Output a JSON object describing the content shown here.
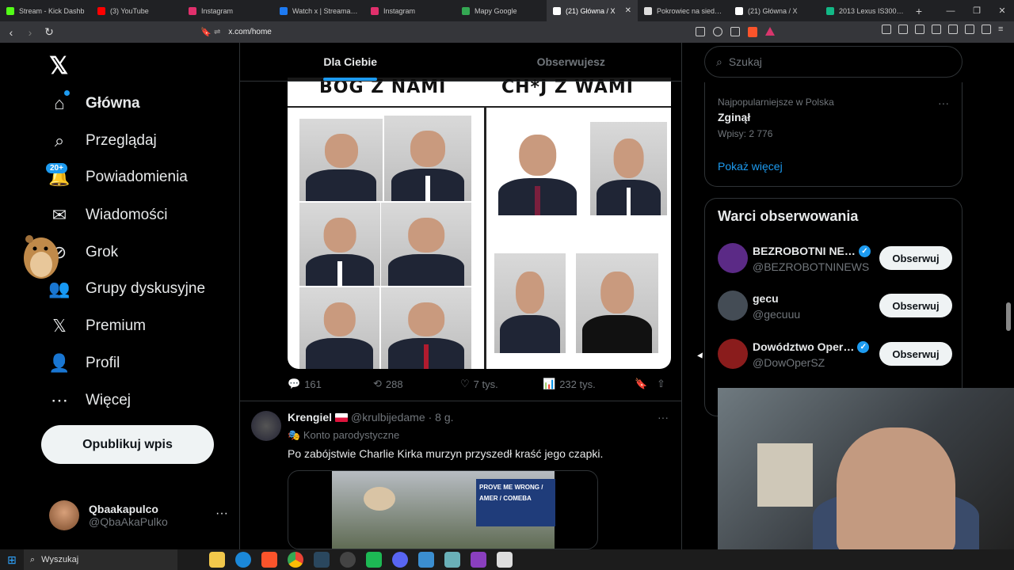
{
  "browser": {
    "tabs": [
      {
        "title": "Stream - Kick Dashb",
        "color": "#53fc18"
      },
      {
        "title": "(3) YouTube",
        "color": "#ff0000"
      },
      {
        "title": "Instagram",
        "color": "#e1306c"
      },
      {
        "title": "Watch x | Streamable",
        "color": "#1d7af2"
      },
      {
        "title": "Instagram",
        "color": "#e1306c"
      },
      {
        "title": "Mapy Google",
        "color": "#34a853"
      },
      {
        "title": "(21) Główna / X",
        "color": "#ffffff",
        "active": true
      },
      {
        "title": "Pokrowiec na siedzeni",
        "color": "#dddddd"
      },
      {
        "title": "(21) Główna / X",
        "color": "#ffffff"
      },
      {
        "title": "2013 Lexus IS300h Elit",
        "color": "#12b886"
      }
    ],
    "url": "x.com/home"
  },
  "sidebar": {
    "nav": [
      {
        "label": "Główna",
        "icon": "home-icon",
        "glyph": "⌂"
      },
      {
        "label": "Przeglądaj",
        "icon": "search-icon",
        "glyph": "⌕"
      },
      {
        "label": "Powiadomienia",
        "icon": "bell-icon",
        "glyph": "🔔"
      },
      {
        "label": "Wiadomości",
        "icon": "envelope-icon",
        "glyph": "✉"
      },
      {
        "label": "Grok",
        "icon": "grok-icon",
        "glyph": "⊘"
      },
      {
        "label": "Grupy dyskusyjne",
        "icon": "communities-icon",
        "glyph": "👥"
      },
      {
        "label": "Premium",
        "icon": "x-premium-icon",
        "glyph": "𝕏"
      },
      {
        "label": "Profil",
        "icon": "profile-icon",
        "glyph": "👤"
      },
      {
        "label": "Więcej",
        "icon": "more-circle-icon",
        "glyph": "⋯"
      }
    ],
    "notif_badge": "20+",
    "post_button": "Opublikuj wpis",
    "account": {
      "name": "Qbaakapulco",
      "handle": "@QbaAkaPulko"
    }
  },
  "feed": {
    "tabs": [
      "Dla Ciebie",
      "Obserwujesz"
    ],
    "tweet1": {
      "image_left_header": "BÓG Z NAMI",
      "image_right_header": "CH*J Z WAMI",
      "replies": "161",
      "reposts": "288",
      "likes": "7 tys.",
      "views": "232 tys."
    },
    "tweet2": {
      "name": "Krengiel",
      "handle": "@krulbijedame",
      "time": "· 8 g.",
      "parody": "Konto parodystyczne",
      "text": "Po zabójstwie Charlie Kirka murzyn przyszedł kraść jego czapki.",
      "sign_text": "PROVE ME WRONG / AMER / COMEBA"
    }
  },
  "right": {
    "search_placeholder": "Szukaj",
    "trend": {
      "category": "Najpopularniejsze w Polska",
      "name": "Zginął",
      "count": "Wpisy: 2 776"
    },
    "show_more": "Pokaż więcej",
    "wtf_title": "Warci obserwowania",
    "suggestions": [
      {
        "name": "BEZROBOTNI NE…",
        "handle": "@BEZROBOTNINEWS",
        "verified": true,
        "follow": "Obserwuj",
        "color": "#5b2a86"
      },
      {
        "name": "gecu",
        "handle": "@gecuuu",
        "verified": false,
        "follow": "Obserwuj",
        "color": "#444c55"
      },
      {
        "name": "Dowództwo Oper…",
        "handle": "@DowOperSZ",
        "verified": true,
        "follow": "Obserwuj",
        "color": "#8a1c1c"
      }
    ]
  },
  "taskbar": {
    "search": "Wyszukaj"
  }
}
